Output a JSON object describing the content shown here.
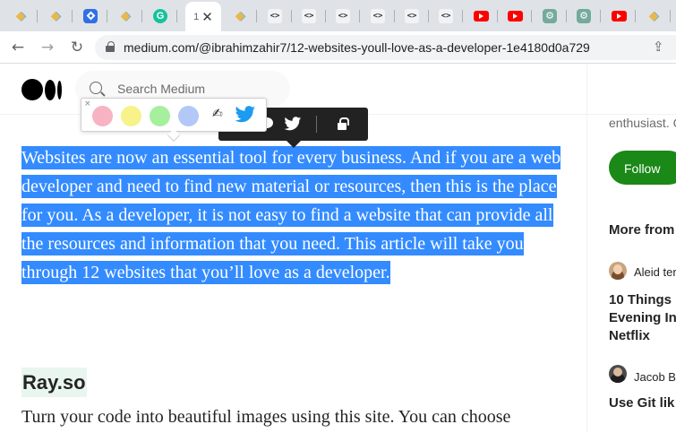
{
  "browser": {
    "tabs": [
      {
        "icon": "gem-icon"
      },
      {
        "icon": "gem-icon"
      },
      {
        "icon": "diamond-blue-icon"
      },
      {
        "icon": "gem-icon"
      },
      {
        "icon": "grammarly-icon",
        "glyph": "G"
      },
      {
        "icon": "tab-number",
        "number": "1",
        "active": true,
        "close": "✕"
      },
      {
        "icon": "gem-icon"
      },
      {
        "icon": "code-icon",
        "glyph": "<>"
      },
      {
        "icon": "code-icon",
        "glyph": "<>"
      },
      {
        "icon": "code-icon",
        "glyph": "<>"
      },
      {
        "icon": "code-icon",
        "glyph": "<>"
      },
      {
        "icon": "code-icon",
        "glyph": "<>"
      },
      {
        "icon": "code-icon",
        "glyph": "<>"
      },
      {
        "icon": "youtube-icon"
      },
      {
        "icon": "youtube-icon"
      },
      {
        "icon": "chatgpt-icon",
        "glyph": "⚙"
      },
      {
        "icon": "chatgpt-icon",
        "glyph": "⚙"
      },
      {
        "icon": "youtube-icon"
      },
      {
        "icon": "gem-icon"
      }
    ],
    "nav": {
      "back": "←",
      "forward": "→",
      "reload": "↻",
      "share": "⇪"
    },
    "url": "medium.com/@ibrahimzahir7/12-websites-youll-love-as-a-developer-1e4180d0a729"
  },
  "header": {
    "search_placeholder": "Search Medium"
  },
  "article": {
    "selected_paragraph": "Websites are now an essential tool for every business. And if you are a web developer and need to find new material or resources, then this is the place for you. As a developer, it is not easy to find a website that can provide all the resources and information that you need. This article will take you through 12 websites that you’ll love as a developer.",
    "heading": "Ray.so",
    "next_paragraph": "Turn your code into beautiful images using this site. You can choose"
  },
  "highlight_tooltip": {
    "icons": [
      "highlight-icon",
      "respond-icon",
      "twitter-icon",
      "private-note-icon"
    ]
  },
  "highlighter_popup": {
    "close": "×",
    "colors": [
      "#f8b3c3",
      "#f7f38a",
      "#a6ef9d",
      "#b3c8f7"
    ],
    "pen": "✍"
  },
  "sidebar": {
    "bio": "enthusiast. C",
    "follow_label": "Follow",
    "more_from": "More from",
    "stories": [
      {
        "author": "Aleid ter",
        "title_lines": [
          "10 Things",
          "Evening In",
          "Netflix"
        ]
      },
      {
        "author": "Jacob Be",
        "title_lines": [
          "Use Git lik"
        ]
      }
    ]
  },
  "colors": {
    "selection": "#338bff",
    "follow_button": "#1a8917",
    "tooltip_bg": "#222222",
    "heading_highlight": "#e9f6ef"
  }
}
